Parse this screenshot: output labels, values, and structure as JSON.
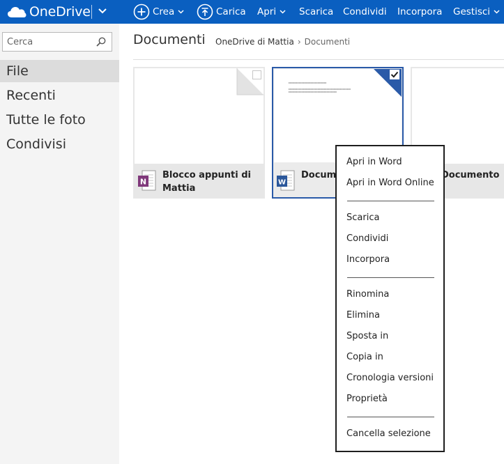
{
  "app": {
    "name": "OneDrive",
    "brand_color": "#0a5fc0"
  },
  "commands": [
    {
      "label": "Crea",
      "icon": "plus-circle-icon",
      "dropdown": true
    },
    {
      "label": "Carica",
      "icon": "upload-icon",
      "dropdown": false
    },
    {
      "label": "Apri",
      "dropdown": true
    },
    {
      "label": "Scarica",
      "dropdown": false
    },
    {
      "label": "Condividi",
      "dropdown": false
    },
    {
      "label": "Incorpora",
      "dropdown": false
    },
    {
      "label": "Gestisci",
      "dropdown": true
    }
  ],
  "sidebar": {
    "search_placeholder": "Cerca",
    "items": [
      {
        "label": "File",
        "active": true
      },
      {
        "label": "Recenti",
        "active": false
      },
      {
        "label": "Tutte le foto",
        "active": false
      },
      {
        "label": "Condivisi",
        "active": false
      }
    ]
  },
  "main": {
    "title": "Documenti",
    "breadcrumb": [
      "OneDrive di Mattia",
      "Documenti"
    ],
    "tiles": [
      {
        "name": "Blocco appunti di Mattia",
        "type": "onenote",
        "selected": false
      },
      {
        "name": "Docume",
        "type": "word",
        "selected": true
      },
      {
        "name": "Documento",
        "type": "word",
        "selected": false
      }
    ]
  },
  "context_menu": {
    "groups": [
      [
        "Apri in Word",
        "Apri in Word Online"
      ],
      [
        "Scarica",
        "Condividi",
        "Incorpora"
      ],
      [
        "Rinomina",
        "Elimina",
        "Sposta in",
        "Copia in",
        "Cronologia versioni",
        "Proprietà"
      ],
      [
        "Cancella selezione"
      ]
    ]
  },
  "colors": {
    "selected_border": "#2a5aa8",
    "onenote": "#80397b",
    "word": "#2b579a"
  }
}
